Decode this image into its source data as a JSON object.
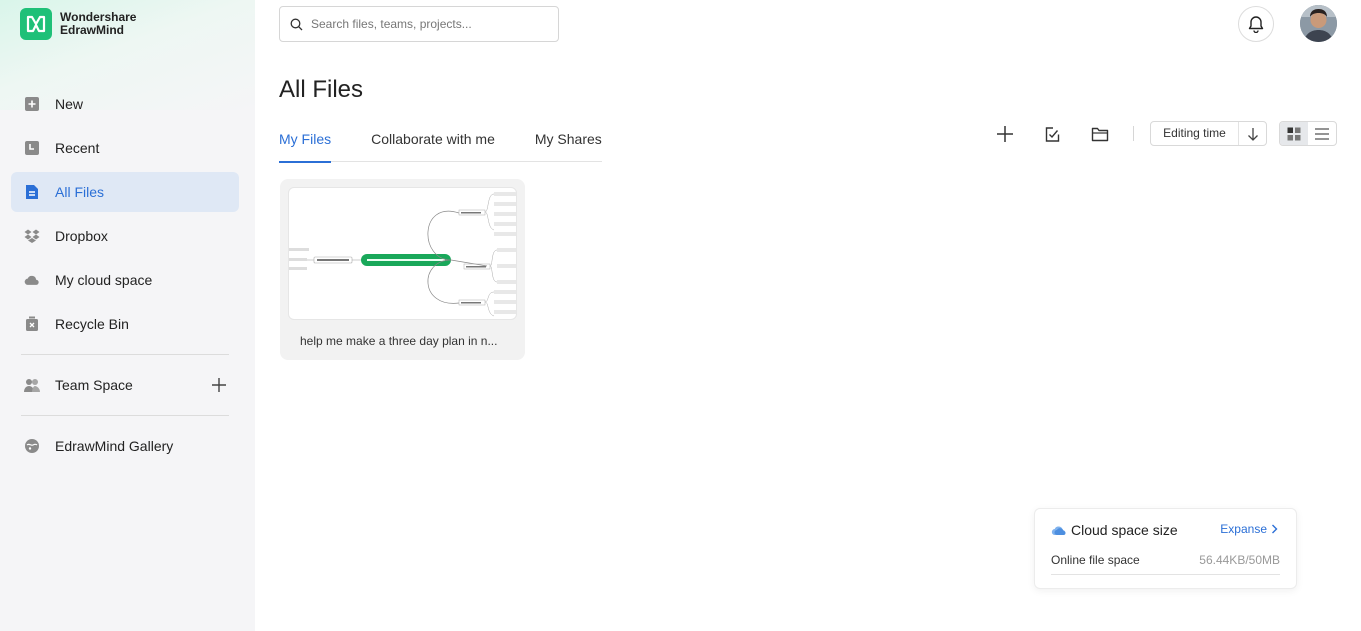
{
  "app": {
    "brand_line1": "Wondershare",
    "brand_line2": "EdrawMind",
    "accent_color": "#2b6fd6",
    "brand_color": "#1fc078"
  },
  "sidebar": {
    "items": [
      {
        "label": "New",
        "icon": "new-file-icon"
      },
      {
        "label": "Recent",
        "icon": "clock-icon"
      },
      {
        "label": "All Files",
        "icon": "document-icon",
        "active": true
      },
      {
        "label": "Dropbox",
        "icon": "dropbox-icon"
      },
      {
        "label": "My cloud space",
        "icon": "cloud-icon"
      },
      {
        "label": "Recycle Bin",
        "icon": "trash-icon"
      }
    ],
    "team_space": "Team Space",
    "gallery": "EdrawMind Gallery"
  },
  "search": {
    "placeholder": "Search files, teams, projects..."
  },
  "page": {
    "title": "All Files"
  },
  "tabs": [
    {
      "label": "My Files",
      "active": true
    },
    {
      "label": "Collaborate with me"
    },
    {
      "label": "My Shares"
    }
  ],
  "toolbar": {
    "sort_label": "Editing time",
    "icons": [
      "plus-icon",
      "import-icon",
      "folder-icon",
      "arrow-down-icon",
      "grid-view-icon",
      "list-view-icon"
    ]
  },
  "files": [
    {
      "name": "help me make a three day plan in n..."
    }
  ],
  "cloud": {
    "title": "Cloud space size",
    "expand": "Expanse",
    "row_label": "Online file space",
    "row_value": "56.44KB/50MB"
  }
}
